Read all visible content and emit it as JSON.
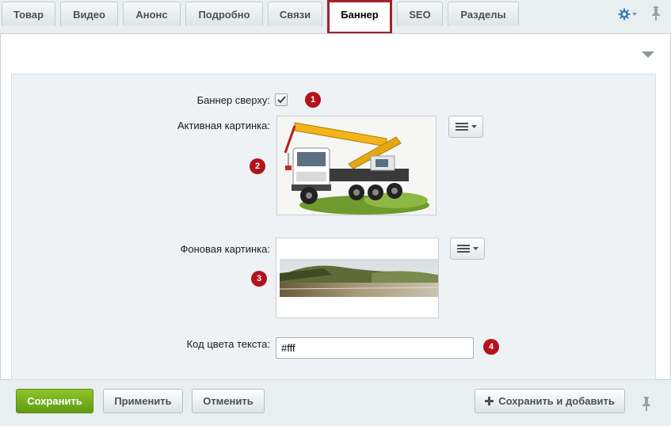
{
  "tabs": [
    {
      "label": "Товар",
      "active": false
    },
    {
      "label": "Видео",
      "active": false
    },
    {
      "label": "Анонс",
      "active": false
    },
    {
      "label": "Подробно",
      "active": false
    },
    {
      "label": "Связи",
      "active": false
    },
    {
      "label": "Баннер",
      "active": true
    },
    {
      "label": "SEO",
      "active": false
    },
    {
      "label": "Разделы",
      "active": false
    }
  ],
  "icons": {
    "settings": "gear-icon",
    "pin": "pin-icon",
    "collapse": "triangle-down-icon",
    "menu": "hamburger-icon",
    "add": "plus-icon"
  },
  "form": {
    "banner_top": {
      "label": "Баннер сверху:",
      "checked": true,
      "badge": "1"
    },
    "active_image": {
      "label": "Активная картинка:",
      "badge": "2"
    },
    "background_image": {
      "label": "Фоновая картинка:",
      "badge": "3"
    },
    "text_color": {
      "label": "Код цвета текста:",
      "value": "#fff",
      "badge": "4"
    }
  },
  "footer": {
    "save": "Сохранить",
    "apply": "Применить",
    "cancel": "Отменить",
    "save_add": "Сохранить и добавить"
  },
  "colors": {
    "accent_red": "#a4212a",
    "badge_red": "#b3121c",
    "save_green": "#6ea81b",
    "gear_blue": "#3a7fc4"
  }
}
